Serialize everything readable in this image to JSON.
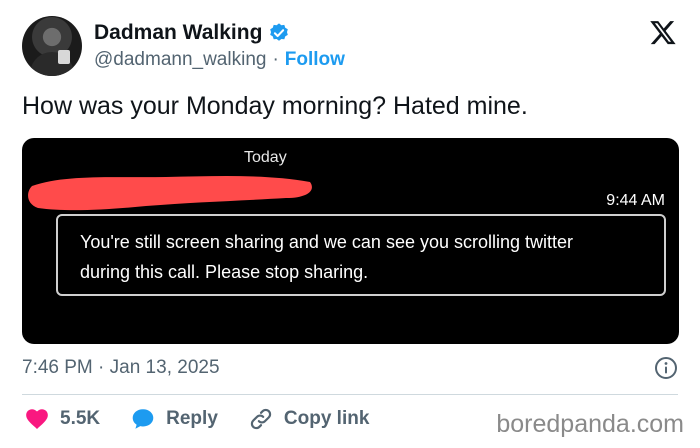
{
  "author": {
    "name": "Dadman Walking",
    "handle": "@dadmann_walking",
    "separator": "·",
    "follow_label": "Follow"
  },
  "tweet": {
    "text": "How was your Monday morning? Hated mine.",
    "timestamp": "7:46 PM · Jan 13, 2025"
  },
  "media": {
    "day_label": "Today",
    "message_time": "9:44 AM",
    "message_line1": "You're still screen sharing and we can see you scrolling twitter",
    "message_line2": "during this call. Please stop sharing."
  },
  "actions": {
    "like_count": "5.5K",
    "reply_label": "Reply",
    "copy_link_label": "Copy link"
  },
  "watermark": "boredpanda.com",
  "colors": {
    "accent": "#1d9bf0",
    "like": "#f91880",
    "redaction": "#ff4b4b",
    "text_secondary": "#536471"
  },
  "icons": [
    "verified-badge-icon",
    "x-logo-icon",
    "info-icon",
    "heart-icon",
    "reply-bubble-icon",
    "link-icon"
  ]
}
